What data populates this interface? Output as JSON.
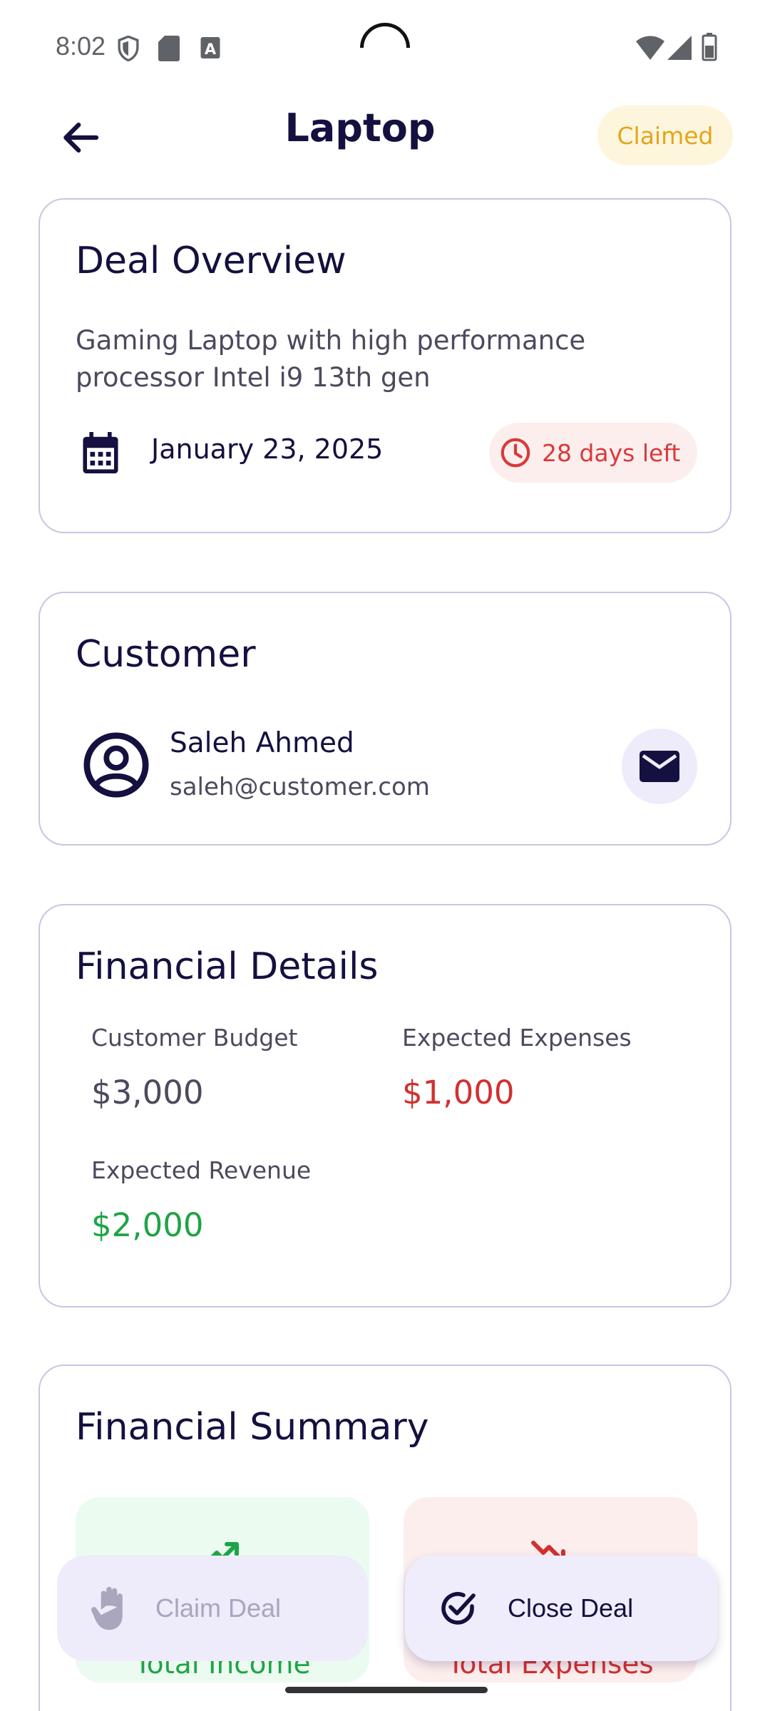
{
  "status_bar": {
    "time": "8:02"
  },
  "header": {
    "title": "Laptop",
    "status": "Claimed"
  },
  "overview": {
    "title": "Deal Overview",
    "description": "Gaming Laptop with high performance processor Intel i9 13th gen",
    "date": "January 23, 2025",
    "days_left": "28 days left"
  },
  "customer": {
    "title": "Customer",
    "name": "Saleh Ahmed",
    "email": "saleh@customer.com"
  },
  "financial_details": {
    "title": "Financial Details",
    "budget_label": "Customer Budget",
    "budget_value": "$3,000",
    "expenses_label": "Expected Expenses",
    "expenses_value": "$1,000",
    "revenue_label": "Expected Revenue",
    "revenue_value": "$2,000"
  },
  "financial_summary": {
    "title": "Financial Summary",
    "income_label": "Total Income",
    "expenses_label": "Total Expenses"
  },
  "actions": {
    "claim_label": "Claim Deal",
    "close_label": "Close Deal"
  },
  "colors": {
    "primary": "#14103f",
    "claimed": "#e4a51c",
    "danger": "#d32f2f",
    "success": "#1ea446",
    "card_border": "#c9c5e3"
  }
}
